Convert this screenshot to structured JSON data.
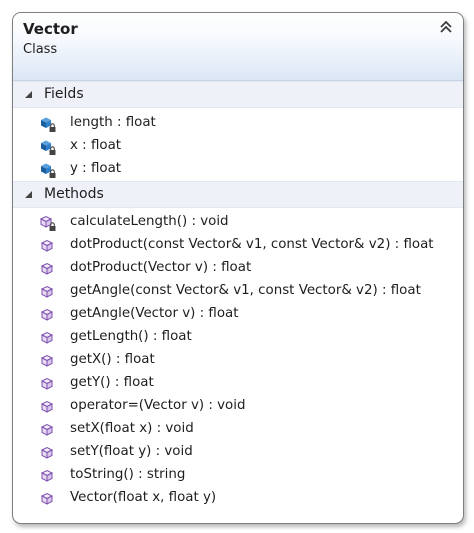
{
  "class": {
    "name": "Vector",
    "stereotype": "Class"
  },
  "sections": {
    "fields": {
      "label": "Fields",
      "items": [
        {
          "text": "length : float",
          "icon": "private-field-icon"
        },
        {
          "text": "x : float",
          "icon": "private-field-icon"
        },
        {
          "text": "y : float",
          "icon": "private-field-icon"
        }
      ]
    },
    "methods": {
      "label": "Methods",
      "items": [
        {
          "text": "calculateLength() : void",
          "icon": "private-method-icon"
        },
        {
          "text": "dotProduct(const Vector& v1, const Vector& v2) : float",
          "icon": "method-icon"
        },
        {
          "text": "dotProduct(Vector v) : float",
          "icon": "method-icon"
        },
        {
          "text": "getAngle(const Vector& v1, const Vector& v2) : float",
          "icon": "method-icon"
        },
        {
          "text": "getAngle(Vector v) : float",
          "icon": "method-icon"
        },
        {
          "text": "getLength() : float",
          "icon": "method-icon"
        },
        {
          "text": "getX() : float",
          "icon": "method-icon"
        },
        {
          "text": "getY() : float",
          "icon": "method-icon"
        },
        {
          "text": "operator=(Vector v) : void",
          "icon": "method-icon"
        },
        {
          "text": "setX(float x) : void",
          "icon": "method-icon"
        },
        {
          "text": "setY(float y) : void",
          "icon": "method-icon"
        },
        {
          "text": "toString() : string",
          "icon": "method-icon"
        },
        {
          "text": "Vector(float x, float y)",
          "icon": "method-icon"
        }
      ]
    }
  },
  "colors": {
    "field_icon": "#1b6fb8",
    "method_icon": "#7e4fb0",
    "lock": "#444444"
  }
}
